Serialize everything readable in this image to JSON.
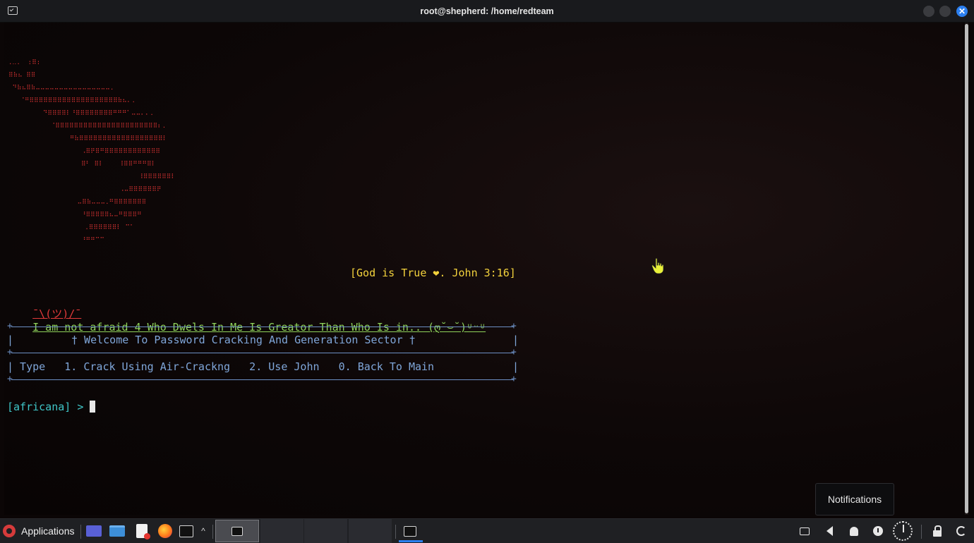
{
  "window": {
    "title": "root@shepherd: /home/redteam",
    "close_glyph": "✕"
  },
  "terminal": {
    "banner_art": ".‥.  :⠿:\n⠿⠷⠦ ⠿⠿\n ⠙⠷⠦⠿⠷⠤⠤⠤⠤⠤⠤⠤⠤⠤⠤⠤⠤⠤⠤⠤⠤.\n   ⠈⠛⠿⠿⠿⠿⠿⠿⠿⠿⠿⠿⠿⠿⠿⠿⠿⠿⠿⠿⠿⠷⠦⠄.\n         ⠙⠿⠿⠿⠿⠇⠘⠿⠿⠿⠿⠿⠿⠿⠿⠛⠛⠛⠁⠤⠤⠄⠄.\n           ⠈⠿⠿⠿⠿⠿⠿⠿⠿⠿⠿⠿⠿⠿⠿⠿⠿⠿⠿⠿⠿⠿⠿⠆.\n                ⠛⠷⠿⠿⠿⠿⠿⠿⠿⠿⠿⠿⠿⠿⠿⠿⠿⠿⠿⠿⠇\n                   ⠠⠿⠟⠿⠛⠿⠿⠿⠿⠿⠿⠿⠿⠿⠿⠿⠿\n                   ⠿⠃ ⠿⠇    ⠸⠿⠿⠛⠛⠛⠿⠇\n                                  ⠸⠿⠿⠿⠿⠿⠿⠇\n                             ⠠⠤⠿⠿⠿⠿⠿⠿⠟\n                  ⠤⠿⠷⠤⠤⠤.⠛⠿⠿⠿⠿⠿⠿⠿\n                   ⠘⠿⠿⠿⠿⠿⠦⠤⠛⠿⠿⠿⠛\n                    .⠿⠿⠿⠿⠿⠿⠇ ⠉⠁\n                   ⠘⠛⠛⠉⠉",
    "verse": "[God is True ❤. John 3:16]",
    "shrug": "¯\\(ツ)/¯",
    "faith_line": "I am not afraid 4 Who Dwels In Me Is Greator Than Who Is in.. (ღ˘⌣˘)ᶸᵕᶸ",
    "box_welcome": "† Welcome To Password Cracking And Generation Sector †",
    "box_options": "| Type   1. Crack Using Air-Crackng   2. Use John   0. Back To Main",
    "box_right_bar": "|",
    "box_left_bar": "|",
    "prompt": "[africana] >"
  },
  "notification_tooltip": "Notifications",
  "taskbar": {
    "applications_label": "Applications",
    "quick_launch": [
      "desktop-icon",
      "file-manager-icon",
      "text-editor-icon",
      "firefox-icon",
      "terminal-icon"
    ],
    "tray": [
      "keyboard-icon",
      "volume-icon",
      "bell-icon",
      "power-icon",
      "clock-icon",
      "lock-icon",
      "logout-icon"
    ]
  },
  "colors": {
    "banner": "#d83232",
    "verse": "#f3d23c",
    "faith": "#8fd35b",
    "box": "#7fa6d9",
    "prompt": "#3fc6c8",
    "accent": "#2b7ff0"
  }
}
